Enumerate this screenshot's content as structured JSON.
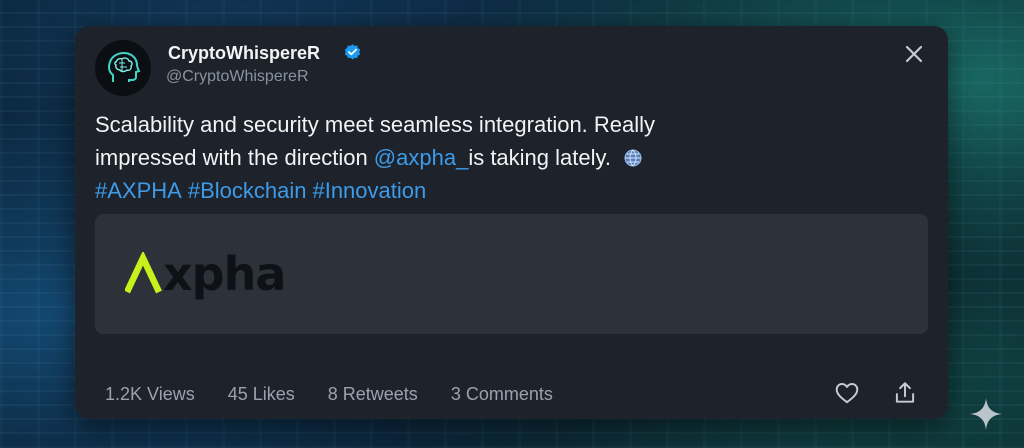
{
  "tweet": {
    "display_name": "CryptoWhispereR",
    "handle": "@CryptoWhispereR",
    "text_line1": "Scalability and security meet seamless integration. Really",
    "text_line2_before": "impressed with the direction ",
    "mention": "@axpha_",
    "text_line2_after": "is taking lately.",
    "hashtags": [
      "#AXPHA",
      "#Blockchain",
      "#Innovation"
    ],
    "media_brand": "xpha"
  },
  "stats": {
    "views": "1.2K Views",
    "likes": "45 Likes",
    "retweets": "8 Retweets",
    "comments": "3 Comments"
  },
  "icons": {
    "avatar": "brain-head-icon",
    "verified": "verified-badge-icon",
    "close": "close-icon",
    "globe": "globe-icon",
    "like": "heart-icon",
    "share": "share-icon",
    "sparkle": "sparkle-icon"
  },
  "colors": {
    "card_bg": "#1d222b",
    "link": "#3d9be8",
    "verified": "#1d9bf0",
    "brand_accent": "#c6f21b",
    "media_bg": "#2d323a"
  }
}
